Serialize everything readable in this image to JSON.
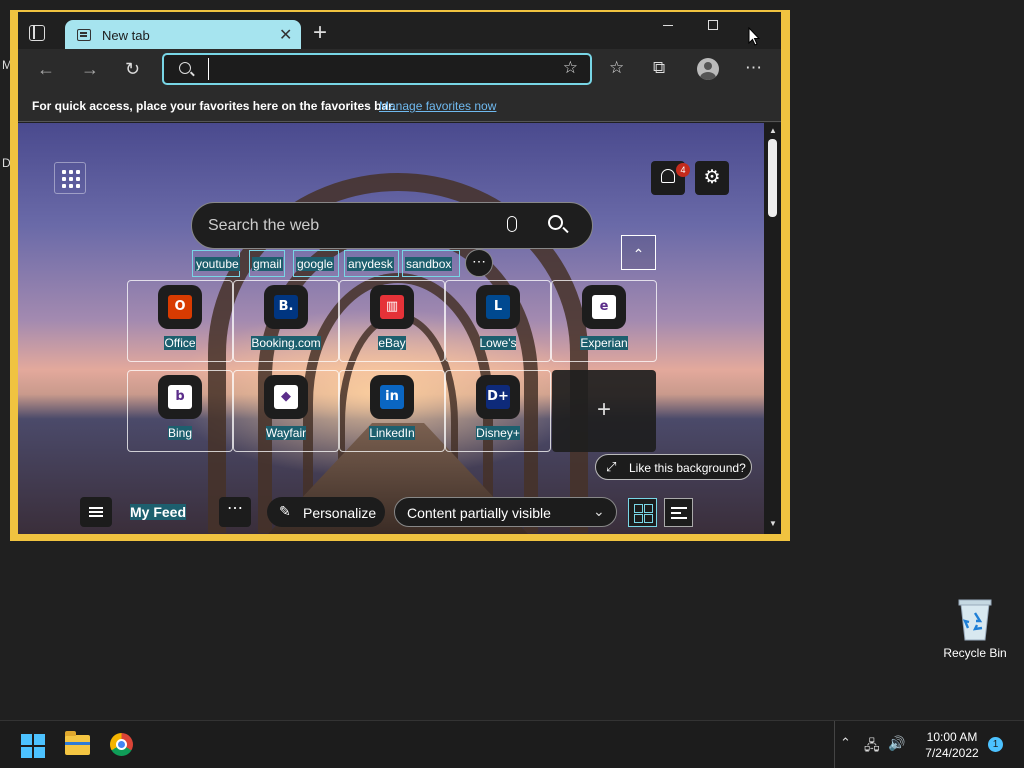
{
  "desktop": {
    "side_letters": [
      "M",
      "D"
    ],
    "recycle_bin_label": "Recycle Bin"
  },
  "browser": {
    "tab": {
      "title": "New tab"
    },
    "address": {
      "value": "",
      "placeholder": ""
    },
    "favorites_bar": {
      "text": "For quick access, place your favorites here on the favorites bar.",
      "link": "Manage favorites now"
    }
  },
  "newtab": {
    "notification_count": "4",
    "search_placeholder": "Search the web",
    "quick_chips": [
      "youtube",
      "gmail",
      "google",
      "anydesk",
      "sandbox"
    ],
    "more_glyph": "⋯",
    "tiles": [
      {
        "name": "Office",
        "icon": "office-icon",
        "color": "#d83b01"
      },
      {
        "name": "Booking.com",
        "icon": "booking-icon",
        "color": "#003580"
      },
      {
        "name": "eBay",
        "icon": "ebay-icon",
        "color": "#e53238"
      },
      {
        "name": "Lowe's",
        "icon": "lowes-icon",
        "color": "#004990"
      },
      {
        "name": "Experian",
        "icon": "experian-icon",
        "color": "#ffffff"
      },
      {
        "name": "Bing",
        "icon": "bing-icon",
        "color": "#ffffff"
      },
      {
        "name": "Wayfair",
        "icon": "wayfair-icon",
        "color": "#ffffff"
      },
      {
        "name": "LinkedIn",
        "icon": "linkedin-icon",
        "color": "#0a66c2"
      },
      {
        "name": "Disney+",
        "icon": "disney-plus-icon",
        "color": "#0e2a7a"
      }
    ],
    "like_background": "Like this background?",
    "feed": {
      "my_feed": "My Feed",
      "personalize": "Personalize",
      "content_visibility": "Content partially visible"
    }
  },
  "taskbar": {
    "time": "10:00 AM",
    "date": "7/24/2022",
    "notifications": "1"
  }
}
